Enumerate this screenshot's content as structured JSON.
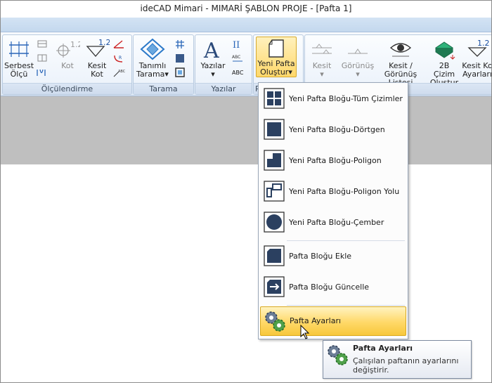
{
  "window": {
    "title": "ideCAD Mimari - MIMARİ ŞABLON PROJE - [Pafta 1]"
  },
  "ribbon": {
    "groups": [
      {
        "label": "Ölçülendirme"
      },
      {
        "label": "Tarama"
      },
      {
        "label": "Yazılar"
      },
      {
        "label": "P"
      },
      {
        "label": "ar"
      }
    ],
    "buttons": {
      "serbest_olcu": "Serbest\nÖlçü",
      "kot": "Kot",
      "kot_value": "1.2",
      "kesit_kot": "Kesit\nKot",
      "kesit_kot_value": "1.2",
      "tanimli_tarama": "Tanımlı\nTarama",
      "yazilar": "Yazılar",
      "yeni_pafta_olustur": "Yeni Pafta\nOluştur",
      "kesit": "Kesit",
      "gorunus": "Görünüş",
      "kesit_gorunus_listesi": "Kesit /\nGörünüş Listesi",
      "cizim_2b_olustur": "2B Çizim\nOluştur",
      "kesit_kot_ayarlari": "Kesit Ko\nAyarları",
      "kesit_kot_ayarlari_value": "1.2"
    }
  },
  "menu": {
    "items": [
      {
        "label": "Yeni Pafta Bloğu-Tüm Çizimler",
        "icon": "pafta-all-icon"
      },
      {
        "label": "Yeni Pafta Bloğu-Dörtgen",
        "icon": "pafta-rect-icon"
      },
      {
        "label": "Yeni Pafta Bloğu-Poligon",
        "icon": "pafta-polygon-icon"
      },
      {
        "label": "Yeni Pafta Bloğu-Poligon Yolu",
        "icon": "pafta-polygon-path-icon"
      },
      {
        "label": "Yeni Pafta Bloğu-Çember",
        "icon": "pafta-circle-icon"
      },
      {
        "label": "Pafta Bloğu Ekle",
        "icon": "pafta-insert-icon"
      },
      {
        "label": "Pafta Bloğu Güncelle",
        "icon": "pafta-update-icon"
      },
      {
        "label": "Pafta Ayarları",
        "icon": "gears-icon",
        "highlighted": true
      }
    ]
  },
  "tooltip": {
    "title": "Pafta Ayarları",
    "description": "Çalışılan paftanın ayarlarını değiştirir."
  },
  "colors": {
    "highlight": "#f9cf52",
    "ribbon_bg": "#e4edf8",
    "canvas_gray": "#bfbfbf"
  }
}
